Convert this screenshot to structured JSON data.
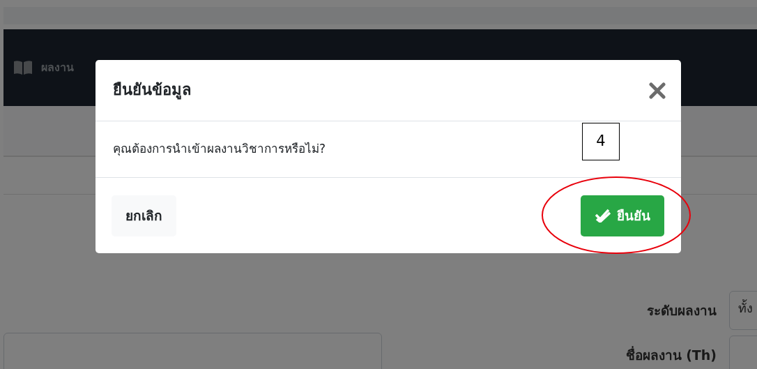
{
  "page": {
    "nav_item": "ผลงาน",
    "fields": [
      {
        "label": "ระดับผลงาน",
        "value": "ทั้ง"
      },
      {
        "label": "ชื่อผลงาน (Th)"
      }
    ]
  },
  "dialog": {
    "title": "ยืนยันข้อมูล",
    "message": "คุณต้องการนำเข้าผลงานวิชาการหรือไม่?",
    "buttons": [
      {
        "label": "ยกเลิก",
        "kind": "secondary"
      },
      {
        "label": "ยืนยัน",
        "kind": "confirm"
      }
    ]
  },
  "annotation": {
    "label": "4"
  }
}
